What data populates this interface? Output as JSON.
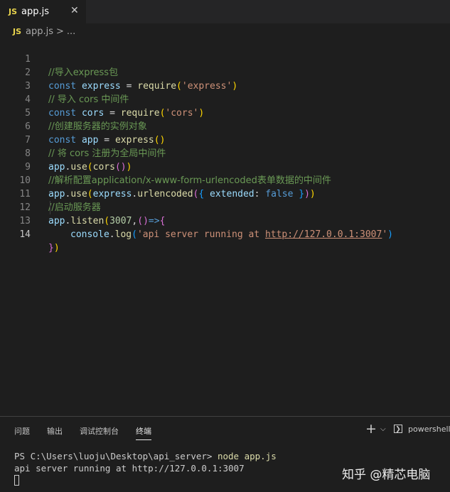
{
  "tab": {
    "icon": "JS",
    "name": "app.js",
    "close": "✕"
  },
  "breadcrumb": {
    "icon": "JS",
    "file": "app.js",
    "sep": ">",
    "more": "..."
  },
  "editor": {
    "lines": [
      {
        "num": "1",
        "comment": "//导入express包"
      },
      {
        "num": "2",
        "kw": "const",
        "var": "express",
        "eq": " = ",
        "fn": "require",
        "open": "(",
        "str": "'express'",
        "close": ")"
      },
      {
        "num": "3",
        "comment": "// 导入 cors 中间件"
      },
      {
        "num": "4",
        "kw": "const",
        "var": "cors",
        "eq": " = ",
        "fn": "require",
        "open": "(",
        "str": "'cors'",
        "close": ")"
      },
      {
        "num": "5",
        "comment": "//创建服务器的实例对象"
      },
      {
        "num": "6",
        "kw": "const",
        "var": "app",
        "eq": " = ",
        "fn": "express",
        "open": "(",
        "close": ")"
      },
      {
        "num": "7",
        "comment": "// 将 cors 注册为全局中间件"
      },
      {
        "num": "8",
        "obj": "app",
        "dot": ".",
        "fn": "use",
        "open": "(",
        "arg": "cors",
        "iopen": "(",
        "iclose": ")",
        "close": ")"
      },
      {
        "num": "9",
        "comment": "//解析配置application/x-www-form-urlencoded表单数据的中间件"
      },
      {
        "num": "10",
        "obj": "app",
        "dot": ".",
        "fn": "use",
        "open": "(",
        "arg": "express",
        "dot2": ".",
        "fn2": "urlencoded",
        "iopen": "(",
        "b1": "{",
        "key": " extended",
        "colon": ": ",
        "val": "false",
        "b2": " }",
        "iclose": ")",
        "close": ")"
      },
      {
        "num": "11",
        "comment": "//启动服务器"
      },
      {
        "num": "12",
        "obj": "app",
        "dot": ".",
        "fn": "listen",
        "open": "(",
        "n": "3007",
        "comma": ",",
        "ar1": "()",
        "arrow": "=>",
        "brace": "{"
      },
      {
        "num": "13",
        "obj": "console",
        "dot": ".",
        "fn": "log",
        "open": "(",
        "s1": "'api server running at ",
        "s2": "http://127.0.0.1:3007",
        "s3": "'",
        "close": ")"
      },
      {
        "num": "14",
        "b1": "}",
        "b2": ")"
      }
    ]
  },
  "panel": {
    "tabs": [
      "问题",
      "输出",
      "调试控制台",
      "终端"
    ],
    "active_tab": "终端",
    "plus": "+",
    "chevron": "⌵",
    "shell_icon": "❯",
    "shell": "powershell",
    "terminal_prompt": "PS C:\\Users\\luoju\\Desktop\\api_server>",
    "terminal_cmd": " node app.js",
    "terminal_output": "api server running at http://127.0.0.1:3007"
  },
  "watermark": "知乎 @精芯电脑",
  "colors": {
    "background": "#1e1e1e",
    "keyword": "#569cd6",
    "string": "#ce9178",
    "comment": "#6a9955",
    "function": "#dcdcaa"
  }
}
